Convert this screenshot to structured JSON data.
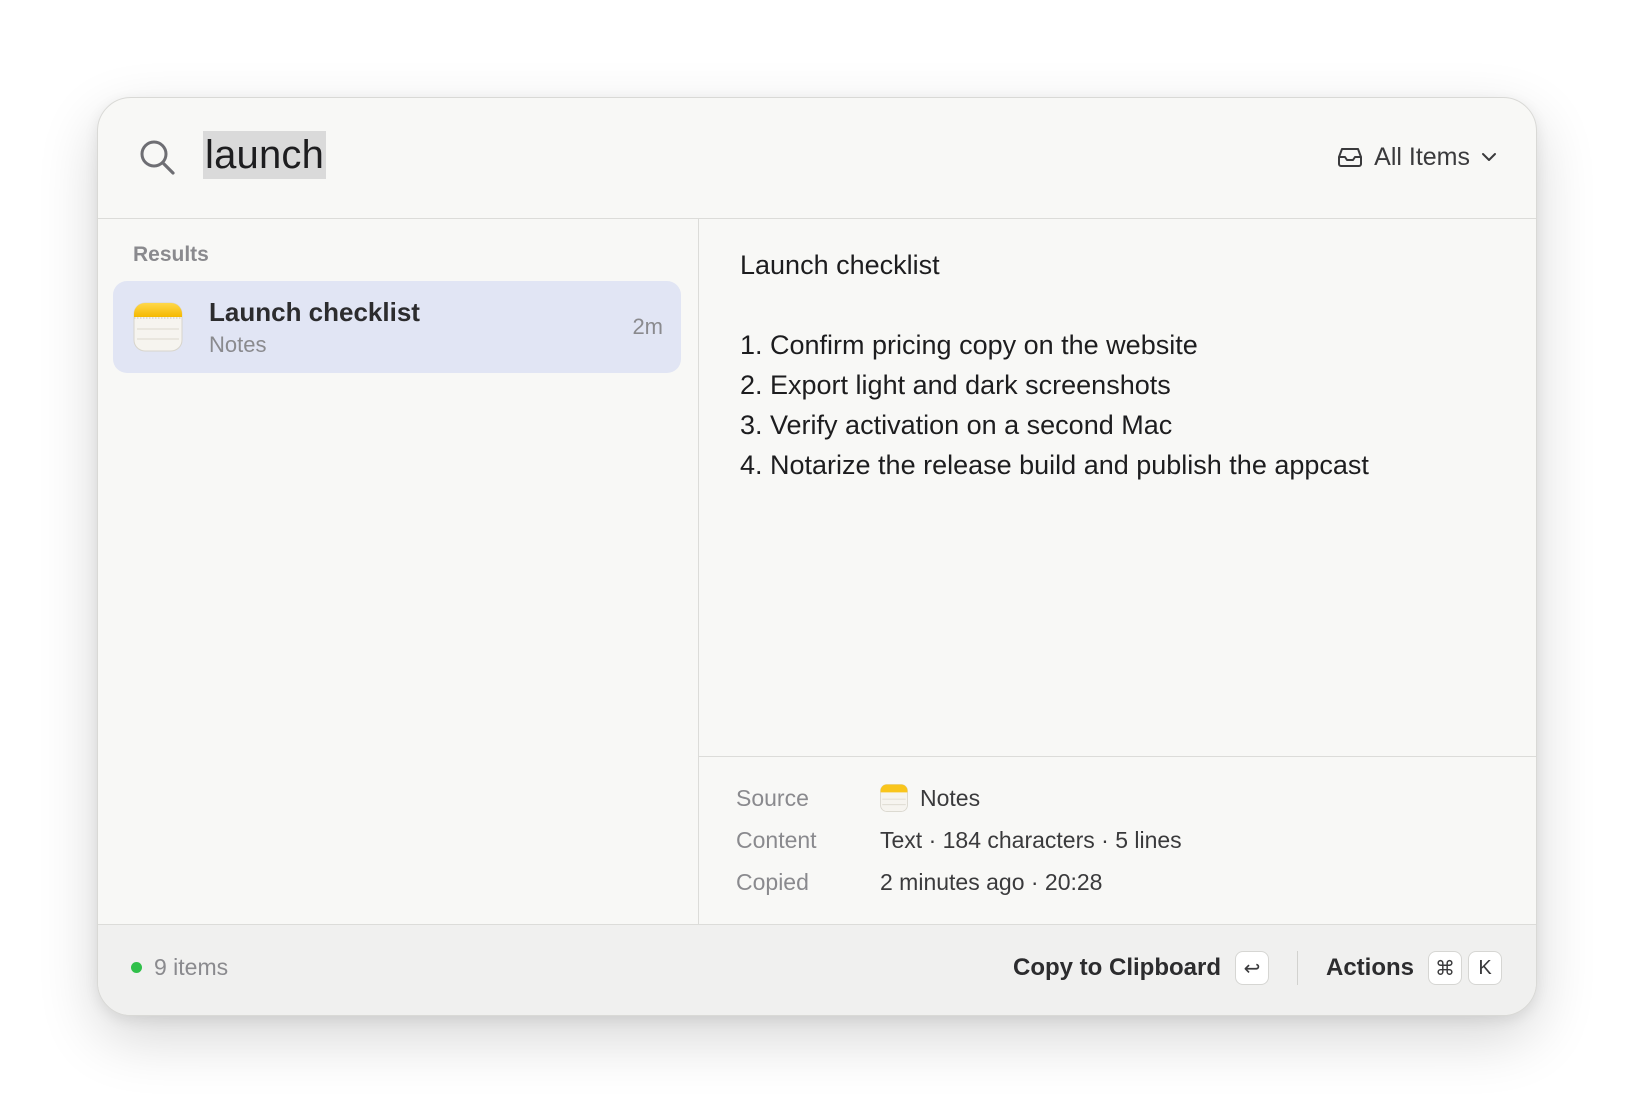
{
  "search": {
    "query": "launch"
  },
  "filter": {
    "label": "All Items",
    "icon": "tray-icon"
  },
  "results": {
    "section_label": "Results",
    "items": [
      {
        "title": "Launch checklist",
        "subtitle": "Notes",
        "time": "2m",
        "icon": "notes-app-icon"
      }
    ]
  },
  "preview": {
    "lines": [
      "Launch checklist",
      "",
      "1. Confirm pricing copy on the website",
      "2. Export light and dark screenshots",
      "3. Verify activation on a second Mac",
      "4. Notarize the release build and publish the appcast"
    ]
  },
  "metadata": {
    "source_label": "Source",
    "source_value": "Notes",
    "content_label": "Content",
    "content_value": "Text · 184 characters · 5 lines",
    "copied_label": "Copied",
    "copied_value": "2 minutes ago · 20:28"
  },
  "footer": {
    "status": "9 items",
    "status_color": "#30c04a",
    "primary_action": "Copy to Clipboard",
    "primary_key": "↩",
    "secondary_action": "Actions",
    "secondary_keys": [
      "⌘",
      "K"
    ]
  },
  "colors": {
    "selection_bg": "#e1e5f4",
    "window_bg": "#f8f8f6",
    "footer_bg": "#f0f0ef"
  }
}
